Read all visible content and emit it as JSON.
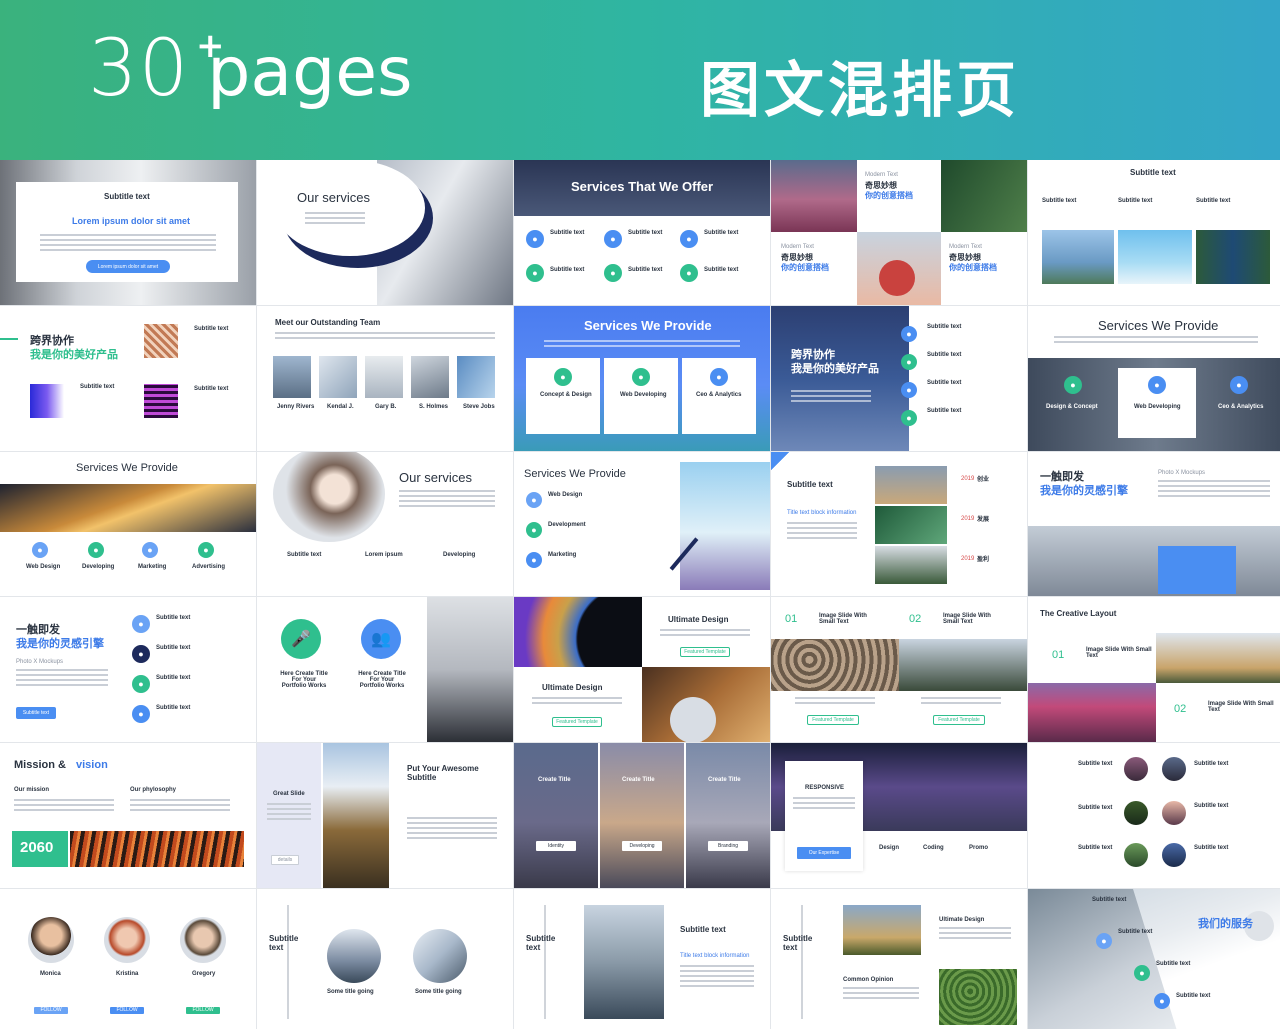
{
  "banner": {
    "count": "30",
    "plus": "+",
    "word": "pages",
    "right_title": "图文混排页"
  },
  "slides": [
    {
      "title": "Subtitle text",
      "heading": "Lorem ipsum dolor sit amet",
      "button": "Lorem ipsum dolor sit amet"
    },
    {
      "title": "Our services"
    },
    {
      "title": "Services That We Offer",
      "items": [
        "Subtitle text",
        "Subtitle text",
        "Subtitle text",
        "Subtitle text",
        "Subtitle text",
        "Subtitle text"
      ]
    },
    {
      "label_a": "Modern Text",
      "title_a": "奇思妙想",
      "sub_a": "你的创意搭档",
      "label_b": "Modern Text",
      "title_b": "奇思妙想",
      "sub_b": "你的创意搭档",
      "label_c": "Modern Text",
      "title_c": "奇思妙想",
      "sub_c": "你的创意搭档"
    },
    {
      "title": "Subtitle text",
      "cols": [
        "Subtitle text",
        "Subtitle text",
        "Subtitle text"
      ]
    },
    {
      "title": "跨界协作",
      "sub": "我是你的美好产品",
      "item_a": "Subtitle text",
      "item_b": "Subtitle text",
      "item_c": "Subtitle text"
    },
    {
      "title": "Meet our Outstanding Team",
      "names": [
        "Jenny Rivers",
        "Kendal J.",
        "Gary B.",
        "S. Holmes",
        "Steve Jobs"
      ]
    },
    {
      "title": "Services We Provide",
      "cards": [
        "Concept & Design",
        "Web Developing",
        "Ceo & Analytics"
      ]
    },
    {
      "title": "跨界协作",
      "sub": "我是你的美好产品",
      "items": [
        "Subtitle text",
        "Subtitle text",
        "Subtitle text",
        "Subtitle text"
      ]
    },
    {
      "title": "Services We Provide",
      "cards": [
        "Design & Concept",
        "Web Developing",
        "Ceo & Analytics"
      ]
    },
    {
      "title": "Services We Provide",
      "items": [
        "Web Design",
        "Developing",
        "Marketing",
        "Advertising"
      ]
    },
    {
      "title": "Our services",
      "cols": [
        "Subtitle text",
        "Lorem ipsum",
        "Developing"
      ]
    },
    {
      "title": "Services We Provide",
      "items": [
        "Web Design",
        "Development",
        "Marketing"
      ]
    },
    {
      "title": "Subtitle text",
      "link": "Title text block information",
      "years": [
        "2019",
        "2019",
        "2019"
      ],
      "words": [
        "创业",
        "发展",
        "盈利"
      ]
    },
    {
      "title": "一触即发",
      "sub": "我是你的灵感引擎",
      "label": "Photo X Mockups"
    },
    {
      "title": "一触即发",
      "sub": "我是你的灵感引擎",
      "label": "Photo X Mockups",
      "button": "Subtitle text",
      "items": [
        "Subtitle text",
        "Subtitle text",
        "Subtitle text",
        "Subtitle text"
      ]
    },
    {
      "items": [
        "Here Create Title For Your Portfolio Works",
        "Here Create Title For Your Portfolio Works"
      ]
    },
    {
      "title_a": "Ultimate Design",
      "title_b": "Ultimate Design",
      "button_a": "Featured Template",
      "button_b": "Featured Template"
    },
    {
      "num_a": "01",
      "label_a": "Image Slide With Small Text",
      "num_b": "02",
      "label_b": "Image Slide With Small Text",
      "button_a": "Featured Template",
      "button_b": "Featured Template"
    },
    {
      "title": "The Creative Layout",
      "num_a": "01",
      "label_a": "Image Slide With Small Text",
      "num_b": "02",
      "label_b": "Image Slide With Small Text"
    },
    {
      "title_a": "Mission &",
      "title_b": "vision",
      "col_a": "Our mission",
      "col_b": "Our phylosophy",
      "year": "2060"
    },
    {
      "side": "Great Slide",
      "title": "Put Your Awesome Subtitle",
      "button": "details"
    },
    {
      "titles": [
        "Create Title",
        "Create Title",
        "Create Title"
      ],
      "buttons": [
        "Identity",
        "Developing",
        "Branding"
      ]
    },
    {
      "label": "RESPONSIVE",
      "button": "Our Expertise",
      "cols": [
        "Design",
        "Coding",
        "Promo"
      ]
    },
    {
      "items": [
        "Subtitle text",
        "Subtitle text",
        "Subtitle text",
        "Subtitle text",
        "Subtitle text",
        "Subtitle text"
      ]
    },
    {
      "names": [
        "Monica",
        "Kristina",
        "Gregory"
      ],
      "buttons": [
        "FOLLOW",
        "FOLLOW",
        "FOLLOW"
      ]
    },
    {
      "label": "Subtitle text",
      "captions": [
        "Some title going",
        "Some title going"
      ]
    },
    {
      "label": "Subtitle text",
      "title": "Subtitle text",
      "link": "Title text block information"
    },
    {
      "label": "Subtitle text",
      "title_a": "Ultimate Design",
      "title_b": "Common Opinion"
    },
    {
      "title": "我们的服务",
      "items": [
        "Subtitle text",
        "Subtitle text",
        "Subtitle text",
        "Subtitle text"
      ]
    }
  ],
  "colors": {
    "green": "#2fbf8e",
    "blue": "#3d7be8",
    "navy": "#1d2a5c",
    "text": "#2a3340"
  }
}
